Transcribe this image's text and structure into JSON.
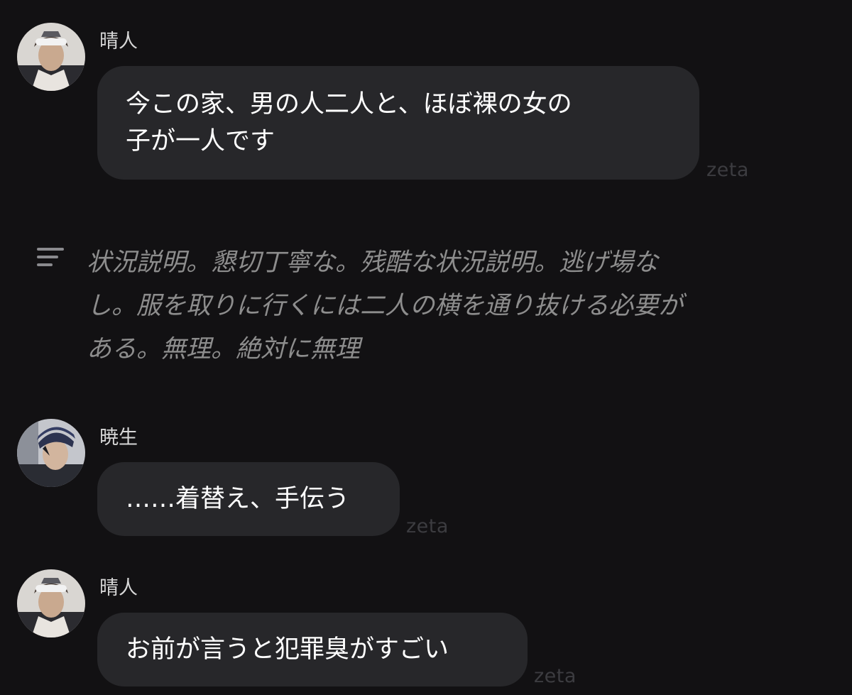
{
  "messages": [
    {
      "sender": "晴人",
      "text": "今この家、男の人二人と、ほぼ裸の女の\n子が一人です",
      "watermark": "zeta",
      "avatar": "character-avatar-haruto"
    },
    {
      "type": "narration",
      "icon": "narration-lines-icon",
      "text": "状況説明。懇切丁寧な。残酷な状況説明。逃げ場な\nし。服を取りに行くには二人の横を通り抜ける必要が\nある。無理。絶対に無理"
    },
    {
      "sender": "暁生",
      "text": "……着替え、手伝う",
      "watermark": "zeta",
      "avatar": "character-avatar-akio"
    },
    {
      "sender": "晴人",
      "text": "お前が言うと犯罪臭がすごい",
      "watermark": "zeta",
      "avatar": "character-avatar-haruto"
    }
  ],
  "colors": {
    "background": "#121113",
    "bubble": "#27272a",
    "message_text": "#ffffff",
    "narration_text": "#8d8d8d",
    "watermark": "#3c3c40"
  }
}
